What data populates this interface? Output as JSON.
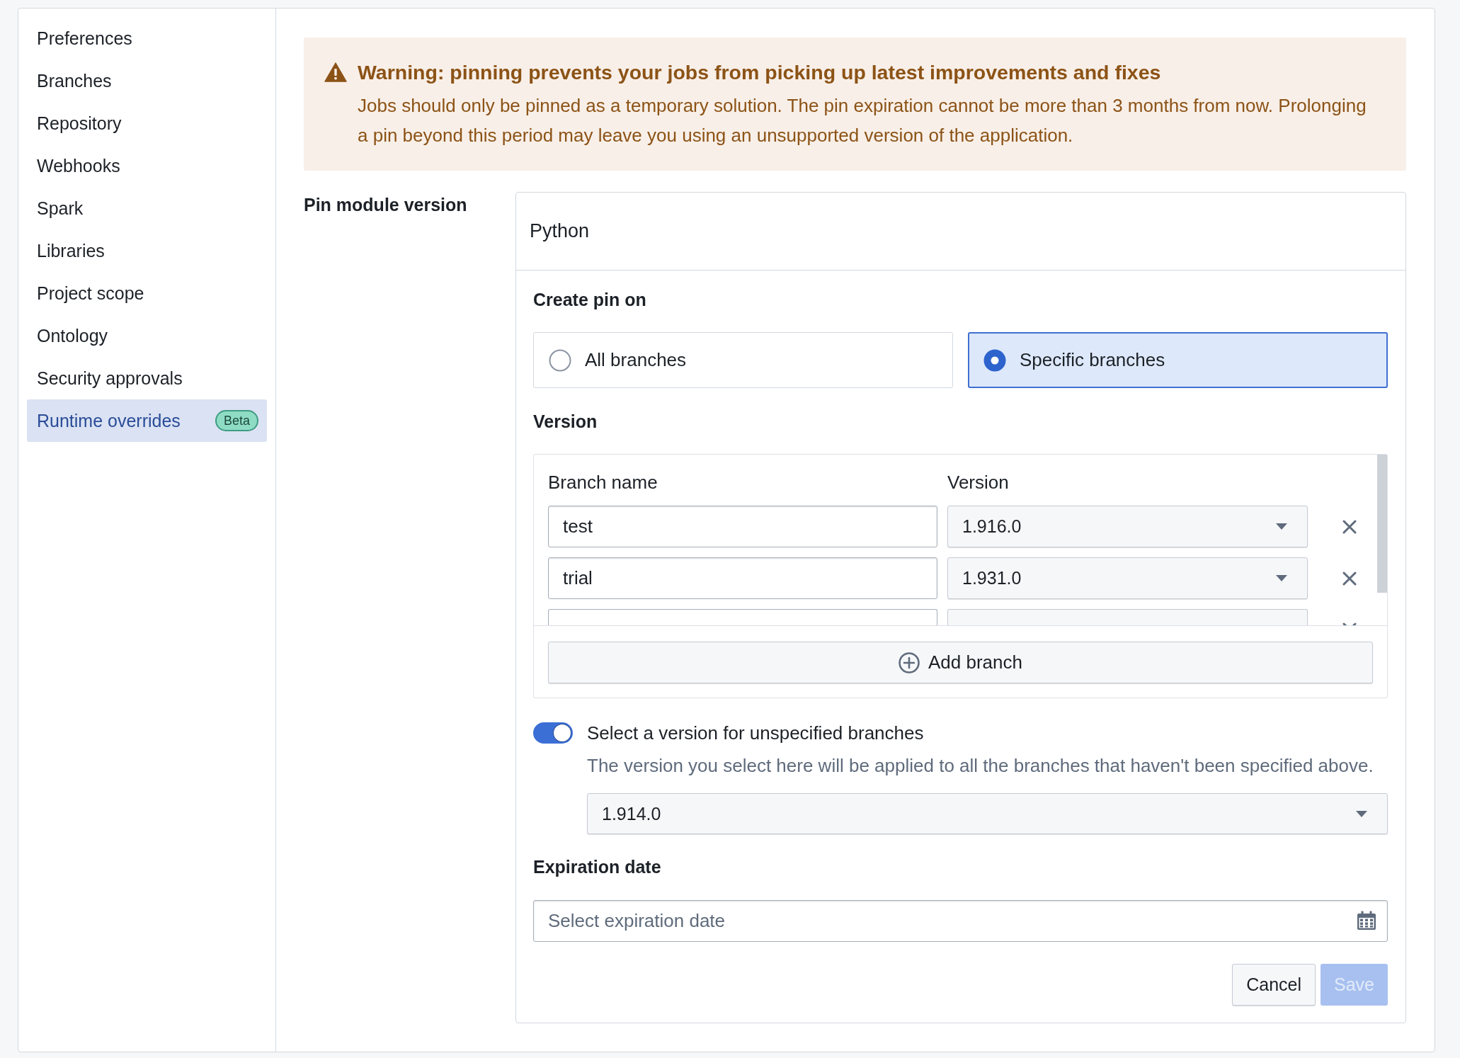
{
  "sidebar": {
    "items": [
      {
        "label": "Preferences",
        "selected": false
      },
      {
        "label": "Branches",
        "selected": false
      },
      {
        "label": "Repository",
        "selected": false
      },
      {
        "label": "Webhooks",
        "selected": false
      },
      {
        "label": "Spark",
        "selected": false
      },
      {
        "label": "Libraries",
        "selected": false
      },
      {
        "label": "Project scope",
        "selected": false
      },
      {
        "label": "Ontology",
        "selected": false
      },
      {
        "label": "Security approvals",
        "selected": false
      },
      {
        "label": "Runtime overrides",
        "selected": true,
        "badge": "Beta"
      }
    ]
  },
  "warning": {
    "title": "Warning: pinning prevents your jobs from picking up latest improvements and fixes",
    "body": "Jobs should only be pinned as a temporary solution. The pin expiration cannot be more than 3 months from now. Prolonging a pin beyond this period may leave you using an unsupported version of the application."
  },
  "form": {
    "label": "Pin module version",
    "module": "Python",
    "create_pin_on": {
      "label": "Create pin on",
      "options": [
        {
          "label": "All branches",
          "selected": false
        },
        {
          "label": "Specific branches",
          "selected": true
        }
      ]
    },
    "version": {
      "label": "Version",
      "columns": [
        "Branch name",
        "Version"
      ],
      "rows": [
        {
          "branch": "test",
          "version": "1.916.0"
        },
        {
          "branch": "trial",
          "version": "1.931.0"
        }
      ],
      "more_rows_below": true,
      "add_button": "Add branch"
    },
    "unspecified": {
      "on": true,
      "label": "Select a version for unspecified branches",
      "description": "The version you select here will be applied to all the branches that haven't been specified above.",
      "value": "1.914.0"
    },
    "expiration": {
      "label": "Expiration date",
      "placeholder": "Select expiration date"
    },
    "buttons": [
      {
        "label": "Cancel",
        "kind": "secondary",
        "disabled": false
      },
      {
        "label": "Save",
        "kind": "primary",
        "disabled": true
      }
    ]
  }
}
